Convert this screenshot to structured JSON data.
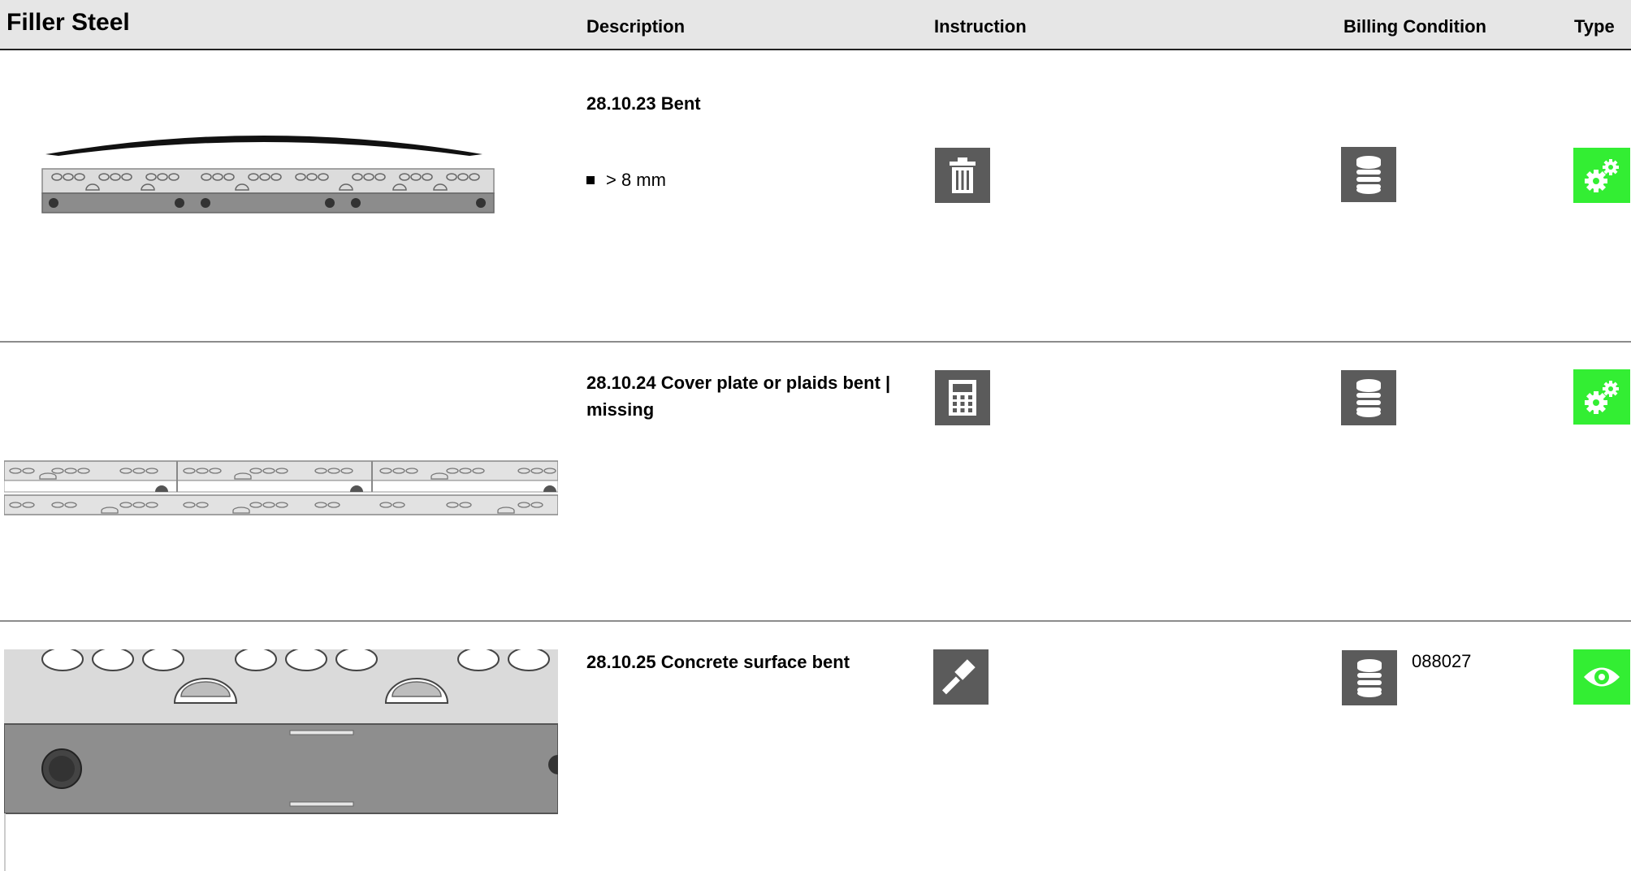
{
  "header": {
    "title": "Filler Steel",
    "columns": {
      "description": "Description",
      "instruction": "Instruction",
      "billing": "Billing Condition",
      "type": "Type"
    }
  },
  "rows": [
    {
      "title": "28.10.23 Bent",
      "bullet": "> 8 mm",
      "instruction_icon": "trash-icon",
      "billing_icon": "coin-stack-icon",
      "billing_code": "",
      "type_icon": "gears-icon"
    },
    {
      "title": "28.10.24 Cover plate or plaids bent | missing",
      "bullet": "",
      "instruction_icon": "calculator-icon",
      "billing_icon": "coin-stack-icon",
      "billing_code": "",
      "type_icon": "gears-icon"
    },
    {
      "title": "28.10.25 Concrete surface bent",
      "bullet": "",
      "instruction_icon": "hammer-icon",
      "billing_icon": "coin-stack-icon",
      "billing_code": "088027",
      "type_icon": "eye-icon"
    }
  ],
  "colors": {
    "header_bg": "#e6e6e6",
    "icon_bg": "#5b5b5b",
    "type_green": "#33ee33"
  }
}
